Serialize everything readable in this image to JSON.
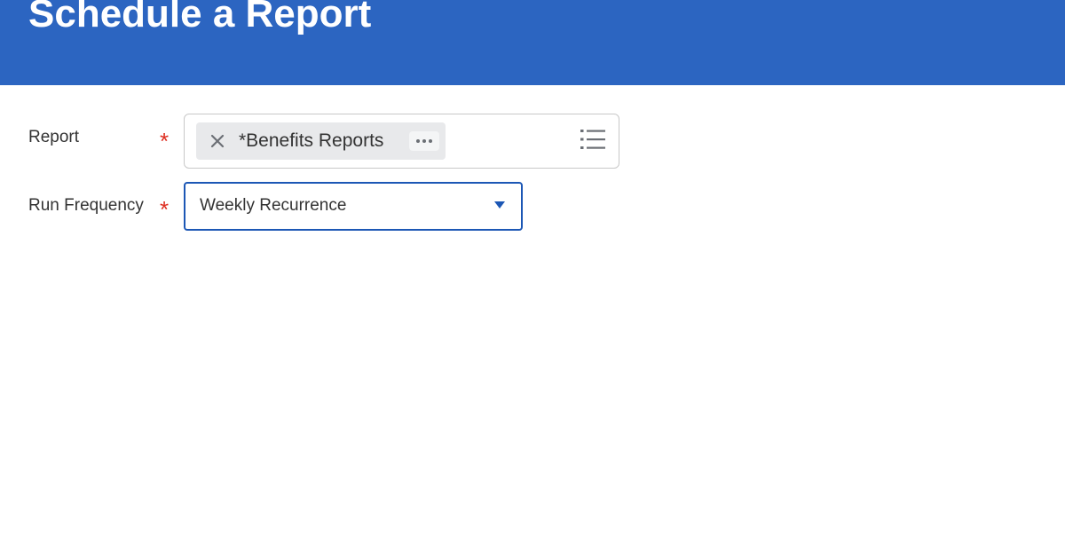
{
  "header": {
    "title": "Schedule a Report"
  },
  "form": {
    "report": {
      "label": "Report",
      "required_marker": "*",
      "selected_item": "*Benefits Reports",
      "remove_icon": "close-icon",
      "more_icon": "ellipsis-icon",
      "prompt_icon": "list-icon"
    },
    "run_frequency": {
      "label": "Run Frequency",
      "required_marker": "*",
      "selected_value": "Weekly Recurrence",
      "dropdown_icon": "caret-down-icon"
    }
  },
  "colors": {
    "header_background": "#2c65c1",
    "required": "#de2e21",
    "focus_border": "#1c57b5",
    "pill_background": "#e8e9eb"
  }
}
